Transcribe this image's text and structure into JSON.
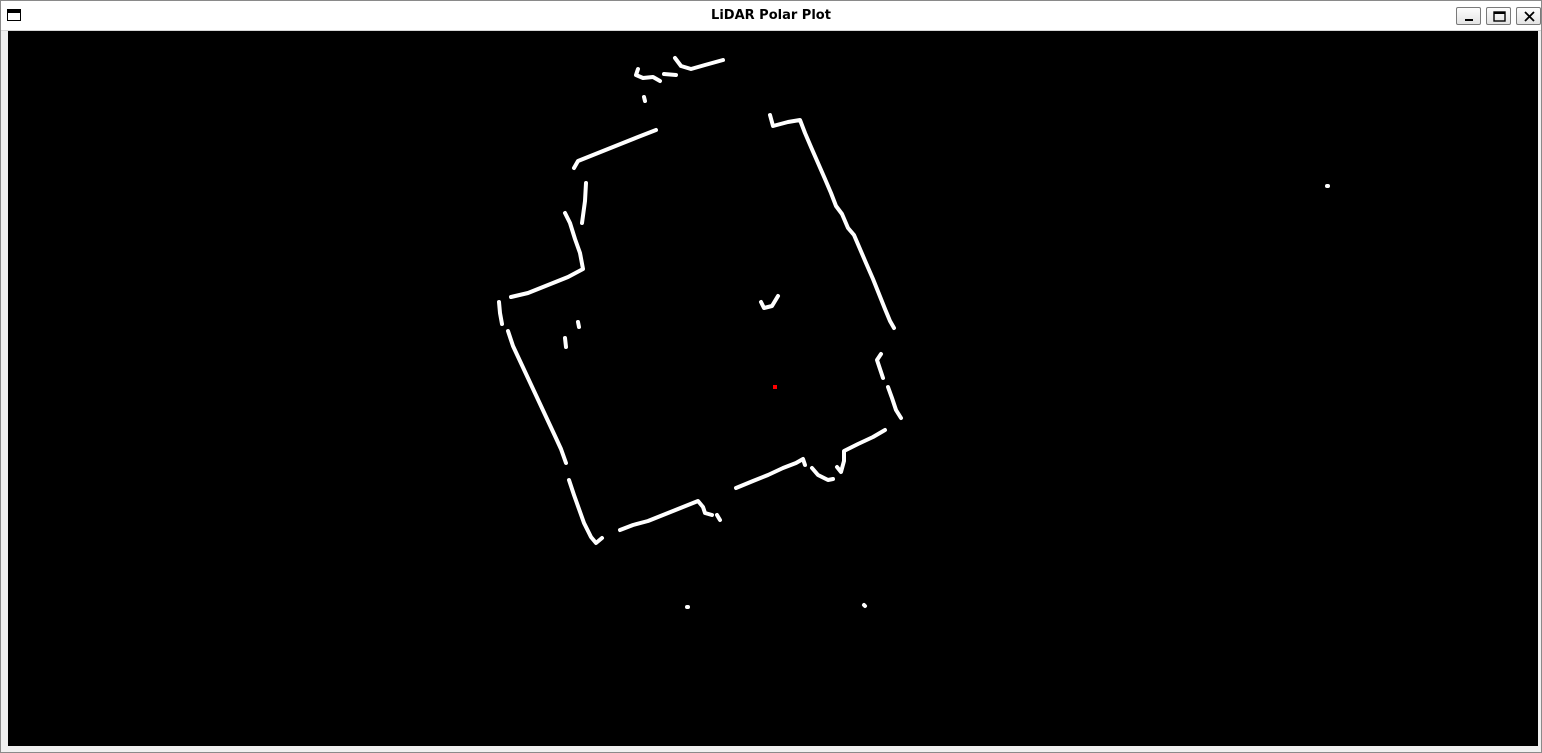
{
  "window": {
    "title": "LiDAR Polar Plot",
    "icons": {
      "app": "window-icon",
      "minimize": "minimize-icon",
      "maximize": "maximize-icon",
      "close": "close-icon"
    }
  },
  "plot": {
    "background": "#000000",
    "point_color": "#ffffff",
    "sensor_color": "#ff0000"
  }
}
